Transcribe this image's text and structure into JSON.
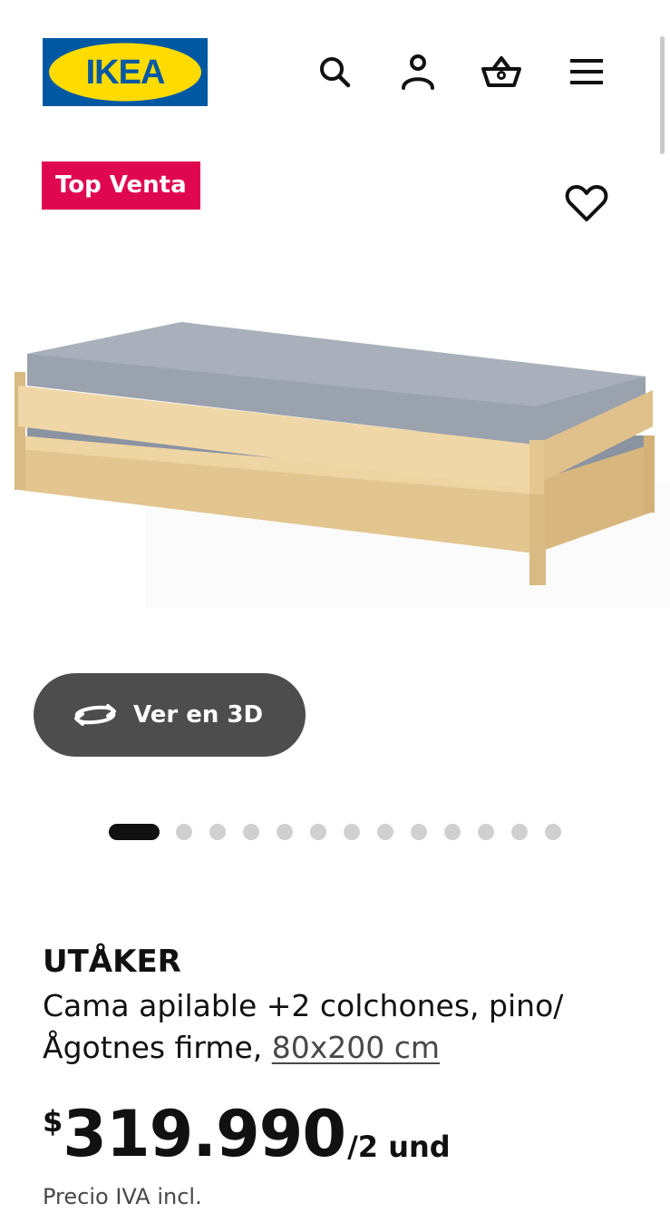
{
  "header": {
    "logo_text": "IKEA",
    "icons": [
      "search-icon",
      "user-icon",
      "cart-icon",
      "menu-icon"
    ]
  },
  "badge": {
    "label": "Top Venta",
    "color": "#e00751"
  },
  "favourite_icon": "heart-icon",
  "view3d": {
    "label": "Ver en 3D",
    "icon": "rotate-3d-icon"
  },
  "carousel": {
    "total": 13,
    "active_index": 0
  },
  "product": {
    "name": "UTÅKER",
    "description_prefix": "Cama apilable +2 colchones, pino/ Ågotnes firme, ",
    "size_link": "80x200 cm",
    "price": {
      "currency": "$",
      "amount": "319.990",
      "unit": "/2 und"
    },
    "vat_note": "Precio IVA incl."
  },
  "colors": {
    "ikea_blue": "#0058a3",
    "ikea_yellow": "#ffdb00",
    "button_gray": "#4d4d4d"
  }
}
